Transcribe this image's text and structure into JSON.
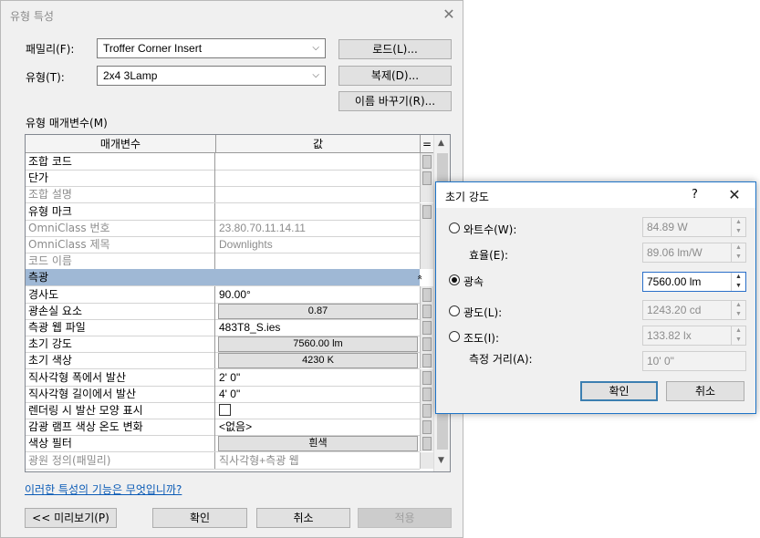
{
  "main_dialog": {
    "title": "유형 특성",
    "close": "✕",
    "family_label": "패밀리(F):",
    "family_value": "Troffer Corner Insert",
    "type_label": "유형(T):",
    "type_value": "2x4 3Lamp",
    "load_button": "로드(L)...",
    "duplicate_button": "복제(D)...",
    "rename_button": "이름 바꾸기(R)...",
    "params_label": "유형 매개변수(M)",
    "col_param": "매개변수",
    "col_value": "값",
    "col_eq": "=",
    "rows": [
      {
        "name": "조합 코드",
        "value": "",
        "style": "normal"
      },
      {
        "name": "단가",
        "value": "",
        "style": "normal"
      },
      {
        "name": "조합 설명",
        "value": "",
        "style": "gray"
      },
      {
        "name": "유형 마크",
        "value": "",
        "style": "normal"
      },
      {
        "name": "OmniClass 번호",
        "value": "23.80.70.11.14.11",
        "style": "gray"
      },
      {
        "name": "OmniClass 제목",
        "value": "Downlights",
        "style": "gray"
      },
      {
        "name": "코드 이름",
        "value": "",
        "style": "gray"
      },
      {
        "name": "측광",
        "value": "",
        "style": "section"
      },
      {
        "name": "경사도",
        "value": "90.00°",
        "style": "normal"
      },
      {
        "name": "광손실 요소",
        "value": "0.87",
        "style": "button"
      },
      {
        "name": "측광 웹 파일",
        "value": "483T8_S.ies",
        "style": "normal"
      },
      {
        "name": "초기 강도",
        "value": "7560.00 lm",
        "style": "button"
      },
      {
        "name": "초기 색상",
        "value": "4230 K",
        "style": "button"
      },
      {
        "name": "직사각형 폭에서 발산",
        "value": "2'  0\"",
        "style": "normal"
      },
      {
        "name": "직사각형 길이에서 발산",
        "value": "4'  0\"",
        "style": "normal"
      },
      {
        "name": "렌더링 시 발산 모양 표시",
        "value": "",
        "style": "checkbox"
      },
      {
        "name": "감광 램프 색상 온도 변화",
        "value": "<없음>",
        "style": "normal"
      },
      {
        "name": "색상 필터",
        "value": "흰색",
        "style": "button"
      },
      {
        "name": "광원 정의(패밀리)",
        "value": "직사각형+측광 웹",
        "style": "gray"
      }
    ],
    "help_link": "이러한 특성의 기능은 무엇입니까?",
    "preview_button": "<< 미리보기(P)",
    "ok_button": "확인",
    "cancel_button": "취소",
    "apply_button": "적용"
  },
  "intensity_dialog": {
    "title": "초기 강도",
    "help": "?",
    "close": "✕",
    "options": [
      {
        "label": "와트수(W):",
        "value": "84.89 W",
        "selected": false
      },
      {
        "label": "광속",
        "value": "7560.00 lm",
        "selected": true
      },
      {
        "label": "광도(L):",
        "value": "1243.20 cd",
        "selected": false
      },
      {
        "label": "조도(I):",
        "value": "133.82 lx",
        "selected": false
      }
    ],
    "efficacy_label": "효율(E):",
    "efficacy_value": "89.06 lm/W",
    "distance_label": "측정 거리(A):",
    "distance_value": "10'  0\"",
    "ok_button": "확인",
    "cancel_button": "취소"
  }
}
